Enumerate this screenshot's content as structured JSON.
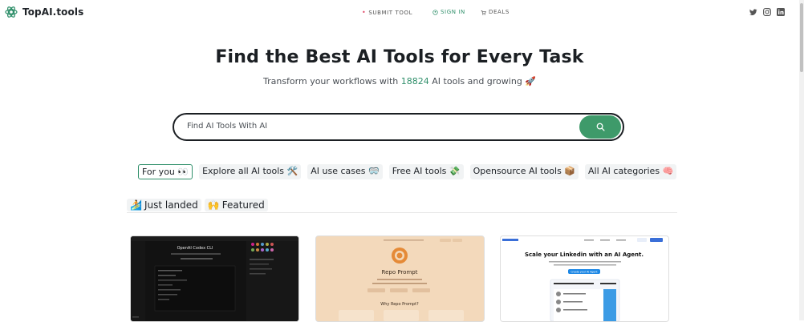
{
  "header": {
    "logo_text": "TopAI.tools",
    "nav": {
      "submit_label": "SUBMIT TOOL",
      "signin_label": "SIGN IN",
      "deals_label": "DEALS"
    },
    "social_icons": [
      "twitter-icon",
      "instagram-icon",
      "linkedin-icon"
    ]
  },
  "hero": {
    "title": "Find the Best AI Tools for Every Task",
    "subtitle_prefix": "Transform your workflows with",
    "tool_count": "18824",
    "subtitle_suffix": "AI tools and growing",
    "subtitle_emoji": "🚀"
  },
  "search": {
    "placeholder": "Find AI Tools With AI",
    "value": ""
  },
  "chips": [
    {
      "label": "For you 👀"
    },
    {
      "label": "Explore all AI tools 🛠️"
    },
    {
      "label": "AI use cases 🥽"
    },
    {
      "label": "Free AI tools 💸"
    },
    {
      "label": "Opensource AI tools 📦"
    },
    {
      "label": "All AI categories 🧠"
    }
  ],
  "tabs": [
    {
      "emoji": "🏄",
      "label": "Just landed"
    },
    {
      "emoji": "🙌",
      "label": "Featured"
    }
  ],
  "cards": [
    {
      "title": "OpenAI Codex CLI"
    },
    {
      "title": "Repo Prompt",
      "subtitle": "Why Repo Prompt?"
    },
    {
      "title": "Scale your Linkedin with an AI Agent.",
      "highlight": "with an AI Agent.",
      "cta": "Create your AI Agent"
    }
  ],
  "colors": {
    "accent": "#2f8f6a",
    "search_button": "#3e9a6a",
    "title": "#1b1f23"
  }
}
